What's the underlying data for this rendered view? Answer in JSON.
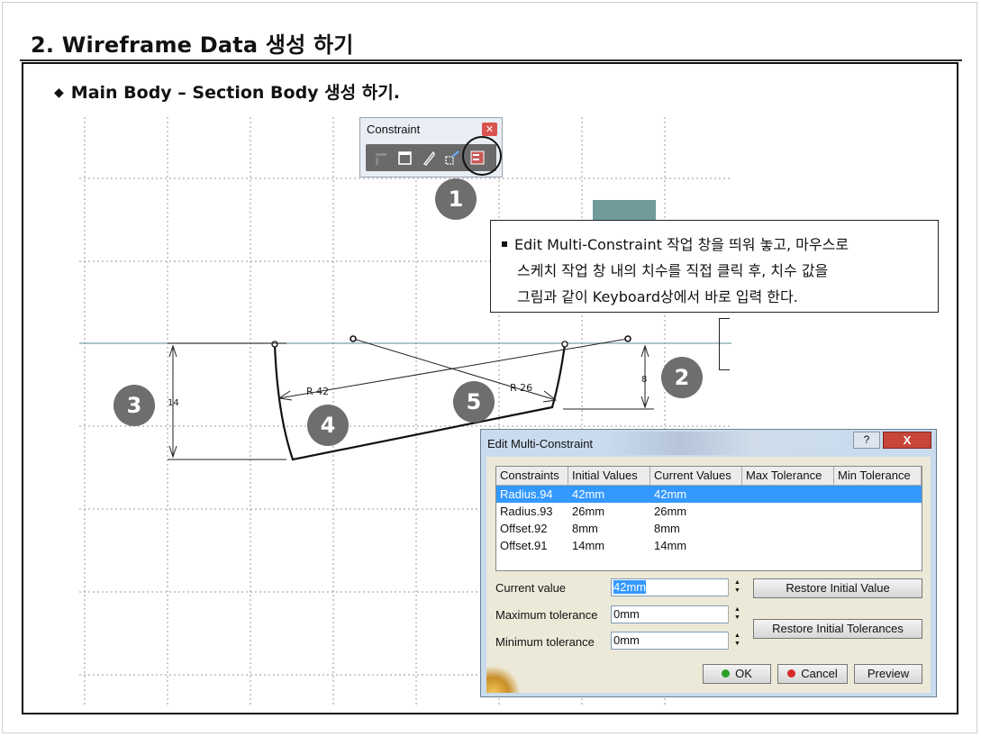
{
  "page": {
    "title": "2. Wireframe Data 생성 하기",
    "subtitle": "Main Body – Section Body 생성 하기.",
    "subtitle_bullet": "◆"
  },
  "toolbar": {
    "title": "Constraint",
    "close_icon": "close-icon",
    "icons": [
      "constraint-icon",
      "fix-together-icon",
      "auto-constraint-icon",
      "animate-constraint-icon",
      "edit-multi-constraint-icon"
    ]
  },
  "callout": {
    "lines": [
      "Edit Multi-Constraint 작업 창을 띄워 놓고, 마우스로",
      "스케치 작업 창 내의 치수를 직접 클릭 후, 치수 값을",
      "그림과 같이 Keyboard상에서 바로 입력 한다."
    ]
  },
  "markers": [
    "1",
    "2",
    "3",
    "4",
    "5"
  ],
  "sketch": {
    "dim_r42": "R 42",
    "dim_r26": "R 26",
    "dim_14": "14",
    "dim_8": "8"
  },
  "dialog": {
    "title": "Edit Multi-Constraint",
    "help_label": "?",
    "close_label": "X",
    "columns": [
      "Constraints",
      "Initial Values",
      "Current Values",
      "Max Tolerance",
      "Min Tolerance"
    ],
    "rows": [
      {
        "name": "Radius.94",
        "initial": "42mm",
        "current": "42mm",
        "selected": true
      },
      {
        "name": "Radius.93",
        "initial": "26mm",
        "current": "26mm",
        "selected": false
      },
      {
        "name": "Offset.92",
        "initial": "8mm",
        "current": "8mm",
        "selected": false
      },
      {
        "name": "Offset.91",
        "initial": "14mm",
        "current": "14mm",
        "selected": false
      }
    ],
    "current_value_label": "Current value",
    "current_value": "42mm",
    "max_tol_label": "Maximum tolerance",
    "max_tol_value": "0mm",
    "min_tol_label": "Minimum tolerance",
    "min_tol_value": "0mm",
    "restore_value_label": "Restore Initial Value",
    "restore_tol_label": "Restore Initial Tolerances",
    "ok_label": "OK",
    "cancel_label": "Cancel",
    "preview_label": "Preview"
  },
  "colors": {
    "marker": "#6e6e6e",
    "selection": "#3399ff",
    "dialog_frame": "#c9dcee",
    "dialog_client": "#ece9d8",
    "ok_dot": "#2aa02a",
    "cancel_dot": "#d62a2a"
  }
}
